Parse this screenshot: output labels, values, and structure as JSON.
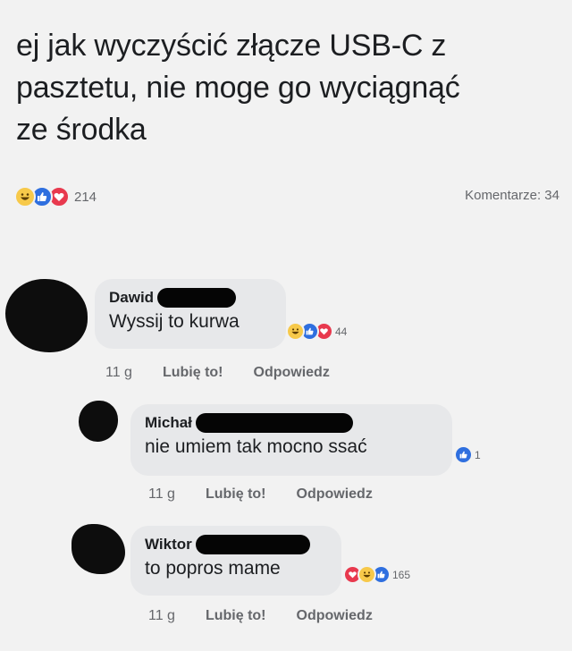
{
  "post": {
    "lines": [
      "ej jak wyczyścić złącze USB-C z",
      "pasztetu, nie moge go wyciągnąć",
      "ze środka"
    ],
    "reaction_count": "214",
    "comments_label": "Komentarze: 34"
  },
  "colors": {
    "like": "#2f6fdf",
    "love": "#e8394e",
    "haha": "#f7c94a",
    "bubble": "#e7e8ea"
  },
  "comments": [
    {
      "author": "Dawid",
      "text": "Wyssij to kurwa",
      "reaction_count": "44",
      "reactions": [
        "haha",
        "like",
        "love"
      ],
      "time": "11 g",
      "like_label": "Lubię to!",
      "reply_label": "Odpowiedz"
    },
    {
      "author": "Michał",
      "text": "nie umiem tak mocno ssać",
      "reaction_count": "1",
      "reactions": [
        "like"
      ],
      "time": "11 g",
      "like_label": "Lubię to!",
      "reply_label": "Odpowiedz"
    },
    {
      "author": "Wiktor",
      "text": "to popros mame",
      "reaction_count": "165",
      "reactions": [
        "love",
        "haha",
        "like"
      ],
      "time": "11 g",
      "like_label": "Lubię to!",
      "reply_label": "Odpowiedz"
    }
  ]
}
